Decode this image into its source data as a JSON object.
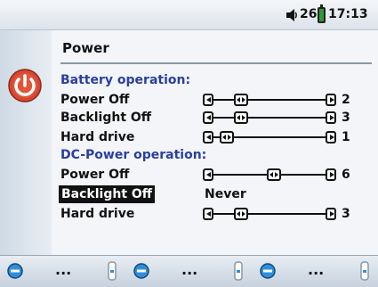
{
  "status_bar": {
    "volume": "26",
    "time": "17:13"
  },
  "page": {
    "title": "Power"
  },
  "sections": [
    {
      "heading": "Battery operation:",
      "rows": [
        {
          "label": "Power Off",
          "value": "2",
          "level": 0.2
        },
        {
          "label": "Backlight Off",
          "value": "3",
          "level": 0.2
        },
        {
          "label": "Hard drive",
          "value": "1",
          "level": 0.05
        }
      ]
    },
    {
      "heading": "DC-Power operation:",
      "rows": [
        {
          "label": "Power Off",
          "value": "6",
          "level": 0.55
        },
        {
          "label": "Backlight Off",
          "value": "Never",
          "selected": true
        },
        {
          "label": "Hard drive",
          "value": "3",
          "level": 0.2
        }
      ]
    }
  ],
  "bottom_bar": {
    "slots": [
      {
        "label": "..."
      },
      {
        "label": "..."
      },
      {
        "label": "..."
      }
    ]
  },
  "colors": {
    "section_heading": "#2a3fa0",
    "power_icon": "#d8462f",
    "battery": "#2f9a3a",
    "button_icon": "#2f8fd8"
  }
}
